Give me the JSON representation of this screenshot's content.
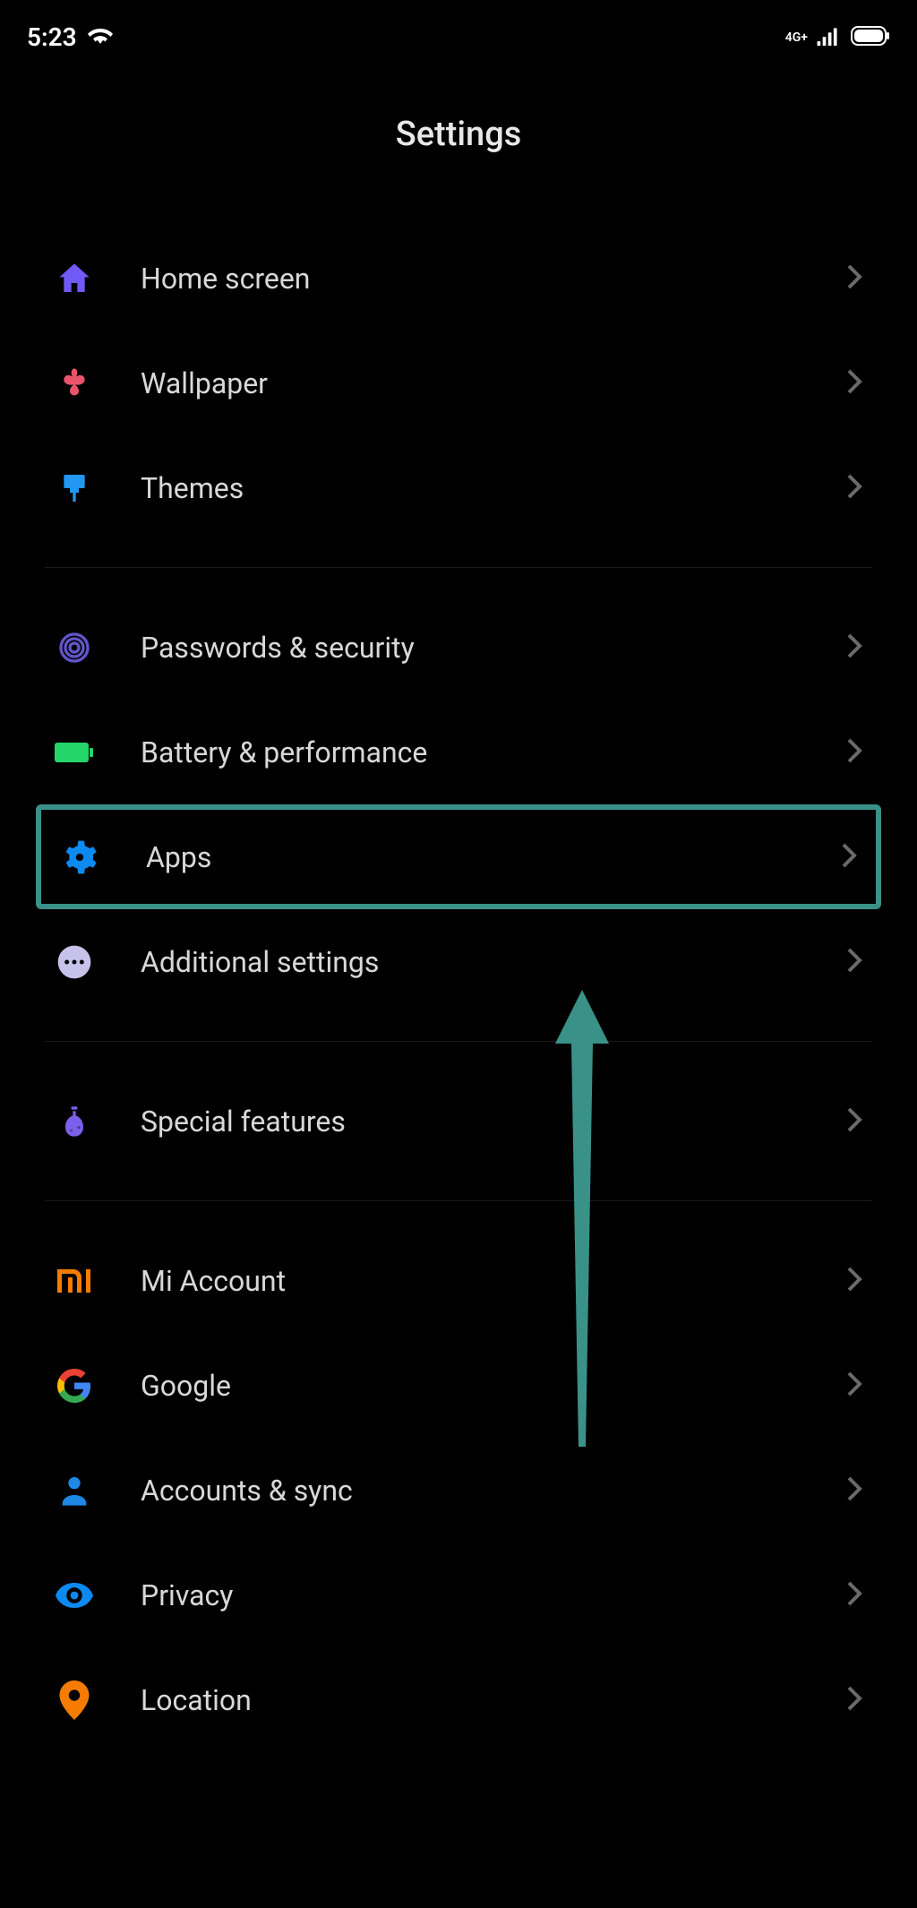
{
  "statusbar": {
    "time": "5:23",
    "network_label": "4G+"
  },
  "header": {
    "title": "Settings"
  },
  "groups": [
    {
      "items": [
        {
          "name": "home-screen",
          "label": "Home screen",
          "icon": "home-icon",
          "color": "c-purple"
        },
        {
          "name": "wallpaper",
          "label": "Wallpaper",
          "icon": "flower-icon",
          "color": "c-pink"
        },
        {
          "name": "themes",
          "label": "Themes",
          "icon": "brush-icon",
          "color": "c-blue"
        }
      ]
    },
    {
      "items": [
        {
          "name": "passwords-security",
          "label": "Passwords & security",
          "icon": "fingerprint-icon",
          "color": "c-indigo"
        },
        {
          "name": "battery-performance",
          "label": "Battery & performance",
          "icon": "battery-icon",
          "color": "c-green"
        },
        {
          "name": "apps",
          "label": "Apps",
          "icon": "gear-icon",
          "color": "c-brightblue",
          "highlighted": true
        },
        {
          "name": "additional-settings",
          "label": "Additional settings",
          "icon": "more-icon",
          "color": "c-lavender"
        }
      ]
    },
    {
      "items": [
        {
          "name": "special-features",
          "label": "Special features",
          "icon": "flask-icon",
          "color": "c-violet"
        }
      ]
    },
    {
      "items": [
        {
          "name": "mi-account",
          "label": "Mi Account",
          "icon": "mi-icon",
          "color": "c-orange"
        },
        {
          "name": "google",
          "label": "Google",
          "icon": "google-icon",
          "color": ""
        },
        {
          "name": "accounts-sync",
          "label": "Accounts & sync",
          "icon": "person-icon",
          "color": "c-lightblue"
        },
        {
          "name": "privacy",
          "label": "Privacy",
          "icon": "eye-icon",
          "color": "c-brightblue"
        },
        {
          "name": "location",
          "label": "Location",
          "icon": "pin-icon",
          "color": "c-orange"
        }
      ]
    }
  ]
}
